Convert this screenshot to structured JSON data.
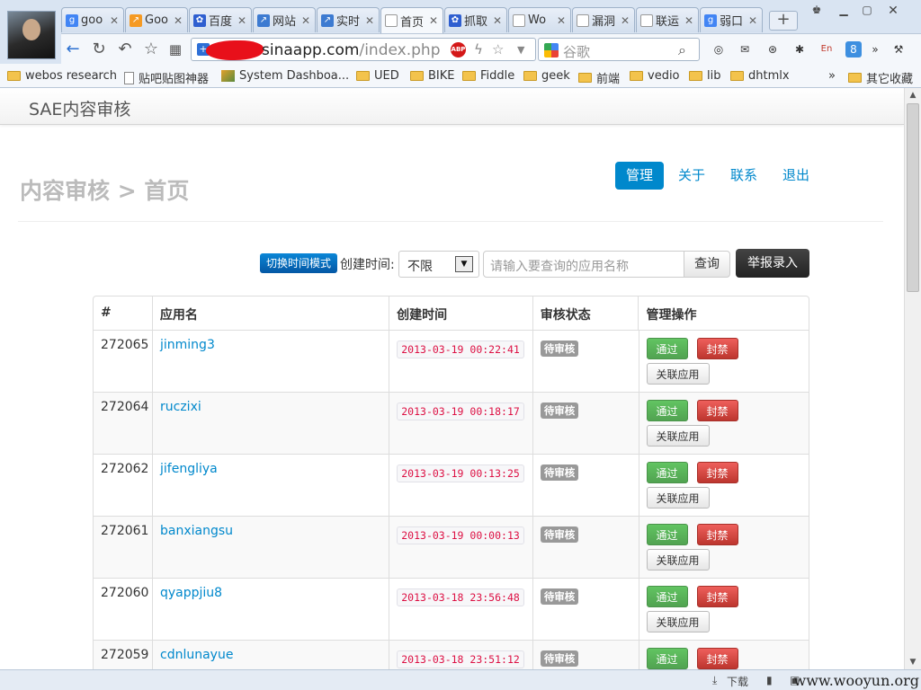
{
  "browser": {
    "tabs": [
      {
        "label": "goo",
        "favicon": "google-g-icon",
        "active": false
      },
      {
        "label": "Goo",
        "favicon": "analytics-icon",
        "active": false
      },
      {
        "label": "百度",
        "favicon": "baidu-paw-icon",
        "active": false
      },
      {
        "label": "网站",
        "favicon": "chart-icon",
        "active": false
      },
      {
        "label": "实时",
        "favicon": "chart-icon",
        "active": false
      },
      {
        "label": "首页",
        "favicon": "page-icon",
        "active": true
      },
      {
        "label": "抓取",
        "favicon": "baidu-paw-icon",
        "active": false
      },
      {
        "label": "Wo",
        "favicon": "page-icon",
        "active": false
      },
      {
        "label": "漏洞",
        "favicon": "page-icon",
        "active": false
      },
      {
        "label": "联运",
        "favicon": "page-icon",
        "active": false
      },
      {
        "label": "弱口",
        "favicon": "google-g-icon",
        "active": false
      }
    ],
    "new_tab": "+",
    "url_host": "sinaapp.com",
    "url_path": "/index.php",
    "search_placeholder": "谷歌",
    "bookmarks": [
      {
        "label": "webos research",
        "icon": "folder-icon"
      },
      {
        "label": "贴吧贴图神器",
        "icon": "page-icon"
      },
      {
        "label": "System Dashboa...",
        "icon": "image-icon"
      },
      {
        "label": "UED",
        "icon": "folder-icon"
      },
      {
        "label": "BIKE",
        "icon": "folder-icon"
      },
      {
        "label": "Fiddle",
        "icon": "folder-icon"
      },
      {
        "label": "geek",
        "icon": "folder-icon"
      },
      {
        "label": "前端",
        "icon": "folder-icon"
      },
      {
        "label": "vedio",
        "icon": "folder-icon"
      },
      {
        "label": "lib",
        "icon": "folder-icon"
      },
      {
        "label": "dhtmlx",
        "icon": "folder-icon"
      }
    ],
    "bookmarks_overflow": "»",
    "other_bookmarks": "其它收藏",
    "status_download": "下载",
    "watermark": "www.wooyun.org"
  },
  "app": {
    "brand": "SAE内容审核",
    "page_title": "内容审核 > 首页",
    "nav": [
      {
        "label": "管理",
        "active": true
      },
      {
        "label": "关于",
        "active": false
      },
      {
        "label": "联系",
        "active": false
      },
      {
        "label": "退出",
        "active": false
      }
    ],
    "filter": {
      "mode_button": "切换时间模式",
      "created_label": "创建时间:",
      "created_value": "不限",
      "query_placeholder": "请输入要查询的应用名称",
      "query_button": "查询",
      "report_button": "举报录入"
    },
    "table": {
      "headers": [
        "#",
        "应用名",
        "创建时间",
        "审核状态",
        "管理操作"
      ],
      "action_pass": "通过",
      "action_ban": "封禁",
      "action_link": "关联应用",
      "rows": [
        {
          "id": "272065",
          "name": "jinming3",
          "created": "2013-03-19 00:22:41",
          "status": "待审核"
        },
        {
          "id": "272064",
          "name": "ruczixi",
          "created": "2013-03-19 00:18:17",
          "status": "待审核"
        },
        {
          "id": "272062",
          "name": "jifengliya",
          "created": "2013-03-19 00:13:25",
          "status": "待审核"
        },
        {
          "id": "272061",
          "name": "banxiangsu",
          "created": "2013-03-19 00:00:13",
          "status": "待审核"
        },
        {
          "id": "272060",
          "name": "qyappjiu8",
          "created": "2013-03-18 23:56:48",
          "status": "待审核"
        },
        {
          "id": "272059",
          "name": "cdnlunayue",
          "created": "2013-03-18 23:51:12",
          "status": "待审核"
        }
      ]
    }
  },
  "colors": {
    "link": "#0088cc",
    "pass": "#51a351",
    "ban": "#bd362f",
    "badge": "#999999",
    "time_code": "#dd1144"
  }
}
